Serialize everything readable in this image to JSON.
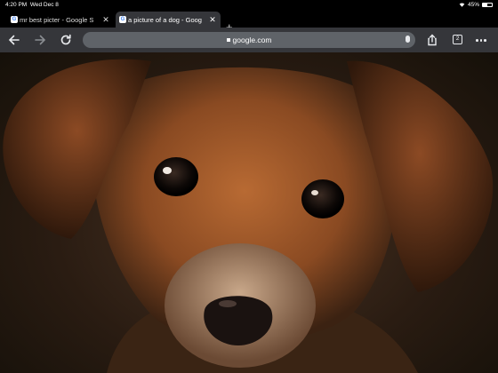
{
  "status_bar": {
    "time": "4:20 PM",
    "date": "Wed Dec 8",
    "battery": "45%",
    "battery_level": 0.45
  },
  "tabs": [
    {
      "title": "mr best picter - Google S",
      "favicon_letter": "G",
      "active": false
    },
    {
      "title": "a picture of a dog - Goog",
      "favicon_letter": "G",
      "active": true
    }
  ],
  "toolbar": {
    "url": "google.com",
    "tab_count": "2"
  },
  "icons": {
    "back": "back-arrow-icon",
    "forward": "forward-arrow-icon",
    "reload": "reload-icon",
    "lock": "lock-icon",
    "mic": "microphone-icon",
    "share": "share-icon",
    "tabs": "tab-switcher-icon",
    "more": "more-options-icon",
    "new_tab": "plus-icon"
  },
  "colors": {
    "tab_active": "#35363a",
    "toolbar": "#35363a",
    "omnibox": "#5f6368"
  }
}
